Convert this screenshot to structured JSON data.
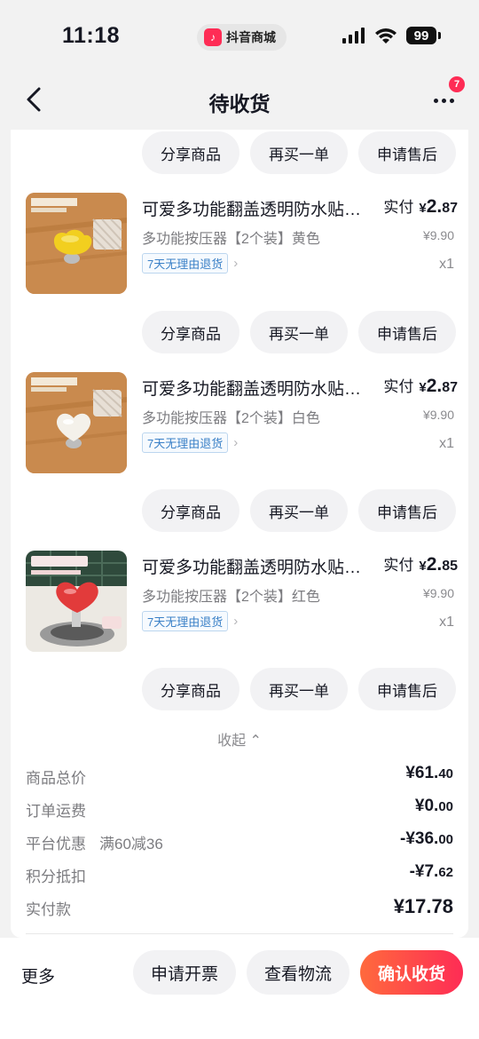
{
  "status_bar": {
    "time": "11:18",
    "app_name": "抖音商城",
    "battery": "99"
  },
  "nav": {
    "title": "待收货",
    "badge_count": "7"
  },
  "actions": {
    "share": "分享商品",
    "rebuy": "再买一单",
    "after_sale": "申请售后"
  },
  "items": [
    {
      "title": "可爱多功能翻盖透明防水贴床头提醒按压器",
      "spec": "多功能按压器【2个装】黄色",
      "tag": "7天无理由退货",
      "pay_label": "实付",
      "price_yen": "¥",
      "price_int": "2.",
      "price_dec": "87",
      "original_price": "¥9.90",
      "qty": "x1",
      "knob_color": "#f2cf1f"
    },
    {
      "title": "可爱多功能翻盖透明防水贴床头提醒按压器",
      "spec": "多功能按压器【2个装】白色",
      "tag": "7天无理由退货",
      "pay_label": "实付",
      "price_yen": "¥",
      "price_int": "2.",
      "price_dec": "87",
      "original_price": "¥9.90",
      "qty": "x1",
      "knob_color": "#f4f1ea"
    },
    {
      "title": "可爱多功能翻盖透明防水贴床头提醒按压器",
      "spec": "多功能按压器【2个装】红色",
      "tag": "7天无理由退货",
      "pay_label": "实付",
      "price_yen": "¥",
      "price_int": "2.",
      "price_dec": "85",
      "original_price": "¥9.90",
      "qty": "x1",
      "knob_color": "#e23b3b"
    }
  ],
  "collapse_label": "收起",
  "summary": {
    "goods_total": {
      "label": "商品总价",
      "main": "¥61.",
      "small": "40"
    },
    "shipping": {
      "label": "订单运费",
      "main": "¥0.",
      "small": "00"
    },
    "discount": {
      "label": "平台优惠",
      "note": "满60减36",
      "main": "-¥36.",
      "small": "00"
    },
    "points": {
      "label": "积分抵扣",
      "main": "-¥7.",
      "small": "62"
    },
    "paid": {
      "label": "实付款",
      "main": "¥17.",
      "small": "78"
    }
  },
  "bottom_bar": {
    "more": "更多",
    "invoice": "申请开票",
    "logistics": "查看物流",
    "confirm": "确认收货"
  },
  "colors": {
    "accent": "#fe2c55",
    "tag_blue": "#3a80c7"
  }
}
